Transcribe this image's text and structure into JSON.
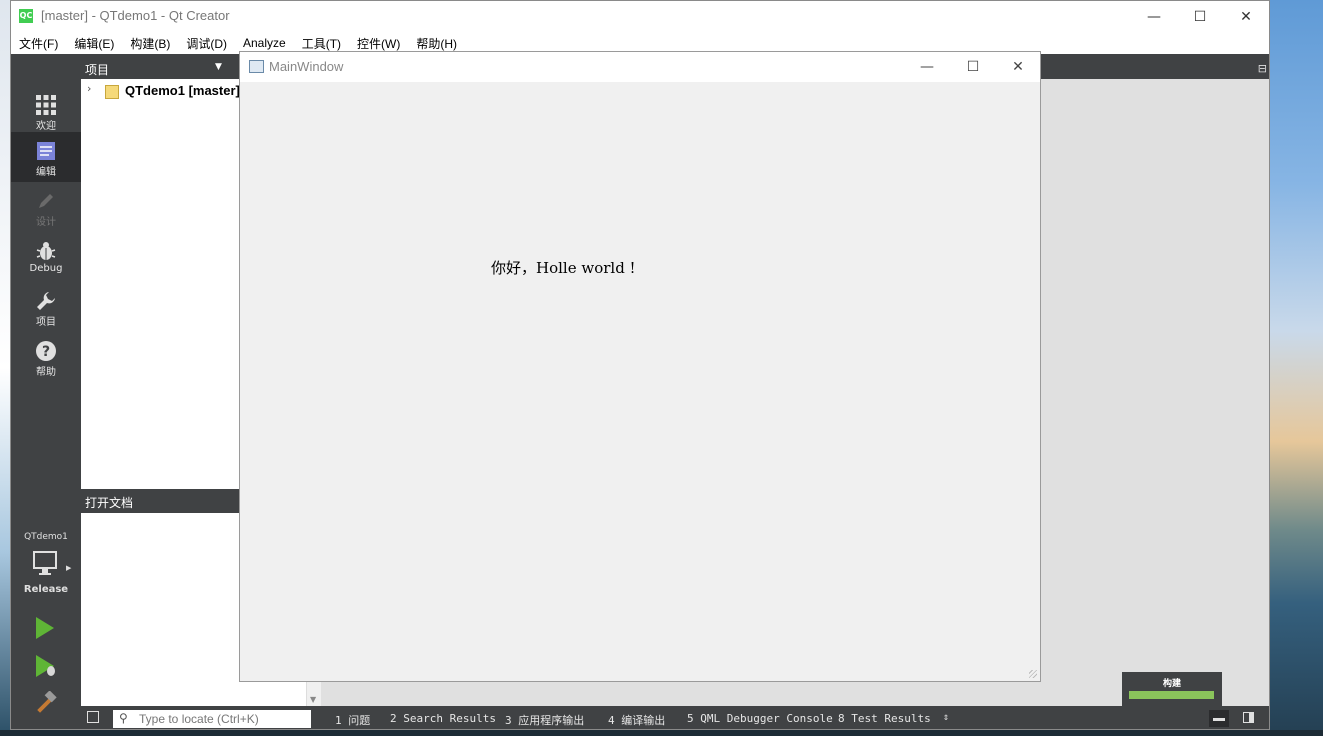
{
  "app": {
    "title": "[master] - QTdemo1 - Qt Creator",
    "logo_text": "QC",
    "window_controls": [
      "—",
      "☐",
      "✕"
    ]
  },
  "menu": [
    "文件(F)",
    "编辑(E)",
    "构建(B)",
    "调试(D)",
    "Analyze",
    "工具(T)",
    "控件(W)",
    "帮助(H)"
  ],
  "modes": [
    {
      "label": "欢迎",
      "icon": "grid-icon"
    },
    {
      "label": "编辑",
      "icon": "document-icon"
    },
    {
      "label": "设计",
      "icon": "pencil-icon"
    },
    {
      "label": "Debug",
      "icon": "bug-icon"
    },
    {
      "label": "项目",
      "icon": "wrench-icon"
    },
    {
      "label": "帮助",
      "icon": "help-icon"
    }
  ],
  "kit": {
    "project": "QTdemo1",
    "build_config": "Release"
  },
  "project_panel": {
    "header": "项目",
    "tree_item": "QTdemo1 [master]"
  },
  "open_documents": {
    "header": "打开文档"
  },
  "locator": {
    "placeholder": "Type to locate (Ctrl+K)"
  },
  "output_tabs": [
    "1 问题",
    "2 Search Results",
    "3 应用程序输出",
    "4 编译输出",
    "5 QML Debugger Console",
    "8 Test Results"
  ],
  "build_progress": {
    "label": "构建",
    "progress": 1.0,
    "color": "#8ac45b"
  },
  "main_window": {
    "title": "MainWindow",
    "label_text": "你好，Holle world !",
    "window_controls": [
      "—",
      "☐",
      "✕"
    ]
  }
}
